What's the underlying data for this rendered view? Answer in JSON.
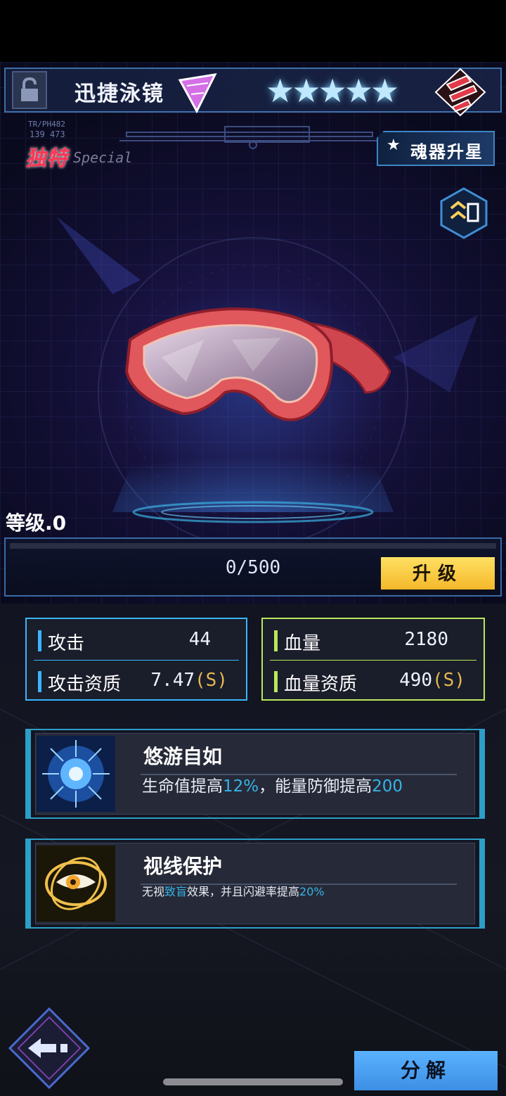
{
  "header": {
    "item_name": "迅捷泳镜",
    "star_count": 5,
    "small_code_1": "TR/PH482",
    "small_code_2": "139 473",
    "rarity": "独特",
    "rarity_en": "Special",
    "star_up_label": "魂器升星"
  },
  "level": {
    "label": "等级.0",
    "exp_text": "0/500",
    "progress": 0,
    "upgrade_label": "升级"
  },
  "stats": {
    "left": [
      {
        "label": "攻击",
        "value": "44",
        "grade": ""
      },
      {
        "label": "攻击资质",
        "value": "7.47",
        "grade": "(S)"
      }
    ],
    "right": [
      {
        "label": "血量",
        "value": "2180",
        "grade": ""
      },
      {
        "label": "血量资质",
        "value": "490",
        "grade": "(S)"
      }
    ]
  },
  "skills": [
    {
      "name": "悠游自如",
      "desc_parts": [
        "生命值提高",
        "12%",
        "，能量防御提高",
        "200"
      ]
    },
    {
      "name": "视线保护",
      "desc_parts": [
        "无视",
        "致盲",
        "效果，并且闪避率提高",
        "20%"
      ]
    }
  ],
  "footer": {
    "decompose_label": "分解"
  },
  "colors": {
    "attack_accent": "#39b6ff",
    "hp_accent": "#b9e85a",
    "upgrade_button": "#f4c431",
    "decompose_button": "#4aa3f2",
    "highlight": "#37b3e6",
    "rarity": "#ff3555"
  }
}
